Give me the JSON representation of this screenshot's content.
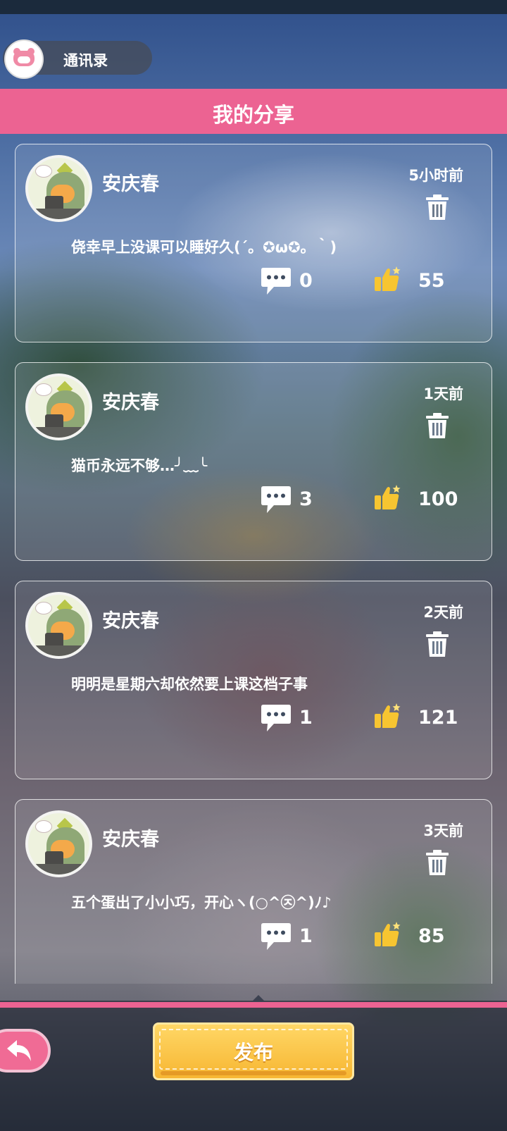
{
  "header": {
    "contacts_label": "通讯录",
    "title": "我的分享"
  },
  "posts": [
    {
      "name": "安庆春",
      "time": "5小时前",
      "message": "侥幸早上没课可以睡好久(´。✪ω✪。｀)",
      "comments": "0",
      "likes": "55"
    },
    {
      "name": "安庆春",
      "time": "1天前",
      "message": "猫币永远不够…╯﹏╰",
      "comments": "3",
      "likes": "100"
    },
    {
      "name": "安庆春",
      "time": "2天前",
      "message": "明明是星期六却依然要上课这档子事",
      "comments": "1",
      "likes": "121"
    },
    {
      "name": "安庆春",
      "time": "3天前",
      "message": "五个蛋出了小小巧，开心ヽ(○^㉨^)ﾉ♪",
      "comments": "1",
      "likes": "85"
    }
  ],
  "footer": {
    "publish_label": "发布"
  },
  "colors": {
    "accent_pink": "#ec6392",
    "publish_yellow": "#f7b632"
  },
  "icons": [
    "contacts-avatar-icon",
    "delete-icon",
    "comment-icon",
    "like-icon",
    "back-arrow-icon"
  ]
}
